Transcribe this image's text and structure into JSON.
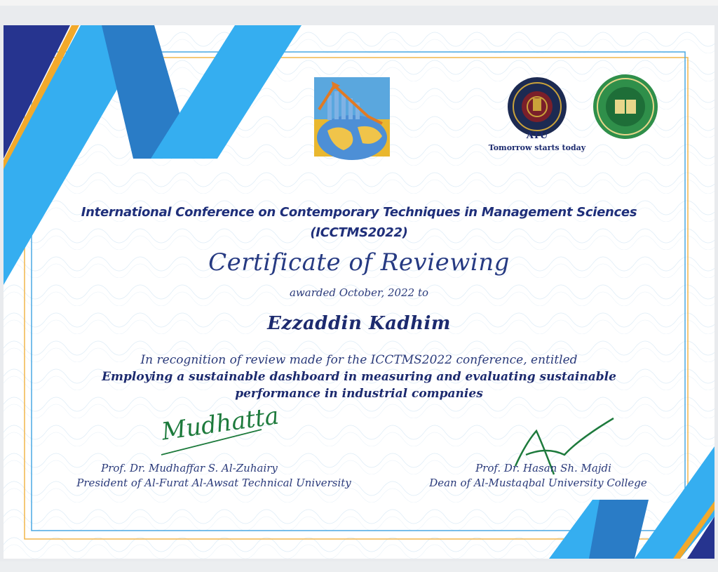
{
  "certificate": {
    "conference_line1": "International Conference on Contemporary Techniques in Management Sciences",
    "conference_line2": "(ICCTMS2022)",
    "title": "Certificate of Reviewing",
    "awarded": "awarded October, 2022 to",
    "recipient": "Ezzaddin Kadhim",
    "recognition": "In recognition of review made for the ICCTMS2022 conference, entitled",
    "paper_title_line1": "Employing a sustainable dashboard in measuring and evaluating sustainable",
    "paper_title_line2": "performance in industrial companies"
  },
  "logos": {
    "atu_name": "ATU",
    "atu_slogan": "Tomorrow starts today"
  },
  "signatories": [
    {
      "name": "Prof. Dr. Mudhaffar S. Al-Zuhairy",
      "role": "President of Al-Furat Al-Awsat Technical University",
      "signature": "Mudhatta"
    },
    {
      "name": "Prof. Dr. Hasan Sh. Majdi",
      "role": "Dean of Al-Mustaqbal University College"
    }
  ],
  "colors": {
    "navy": "#26348f",
    "blue": "#2a93d9",
    "sky": "#35aef0",
    "gold": "#f2a92b",
    "text": "#1f2f7a",
    "signature_green": "#1d7a3c"
  }
}
